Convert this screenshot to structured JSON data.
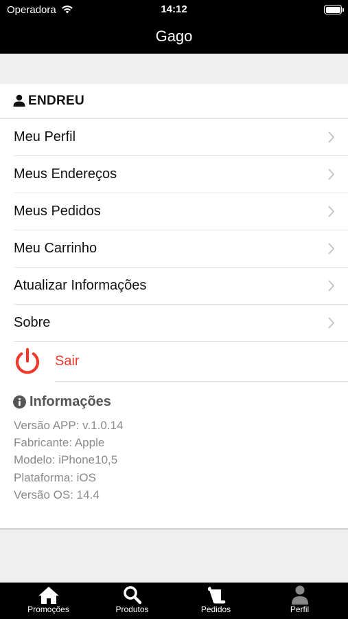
{
  "status": {
    "carrier": "Operadora",
    "time": "14:12"
  },
  "navbar": {
    "title": "Gago"
  },
  "user": {
    "name": "ENDREU"
  },
  "menu": [
    {
      "label": "Meu Perfil"
    },
    {
      "label": "Meus Endereços"
    },
    {
      "label": "Meus Pedidos"
    },
    {
      "label": "Meu Carrinho"
    },
    {
      "label": "Atualizar Informações"
    },
    {
      "label": "Sobre"
    }
  ],
  "logout": {
    "label": "Sair",
    "color": "#ee3a2c"
  },
  "info": {
    "title": "Informações",
    "lines": [
      "Versão APP: v.1.0.14",
      "Fabricante: Apple",
      "Modelo: iPhone10,5",
      "Plataforma: iOS",
      "Versão OS: 14.4"
    ]
  },
  "tabs": [
    {
      "label": "Promoções",
      "icon": "home-icon"
    },
    {
      "label": "Produtos",
      "icon": "search-icon"
    },
    {
      "label": "Pedidos",
      "icon": "orders-icon"
    },
    {
      "label": "Perfil",
      "icon": "profile-icon"
    }
  ]
}
